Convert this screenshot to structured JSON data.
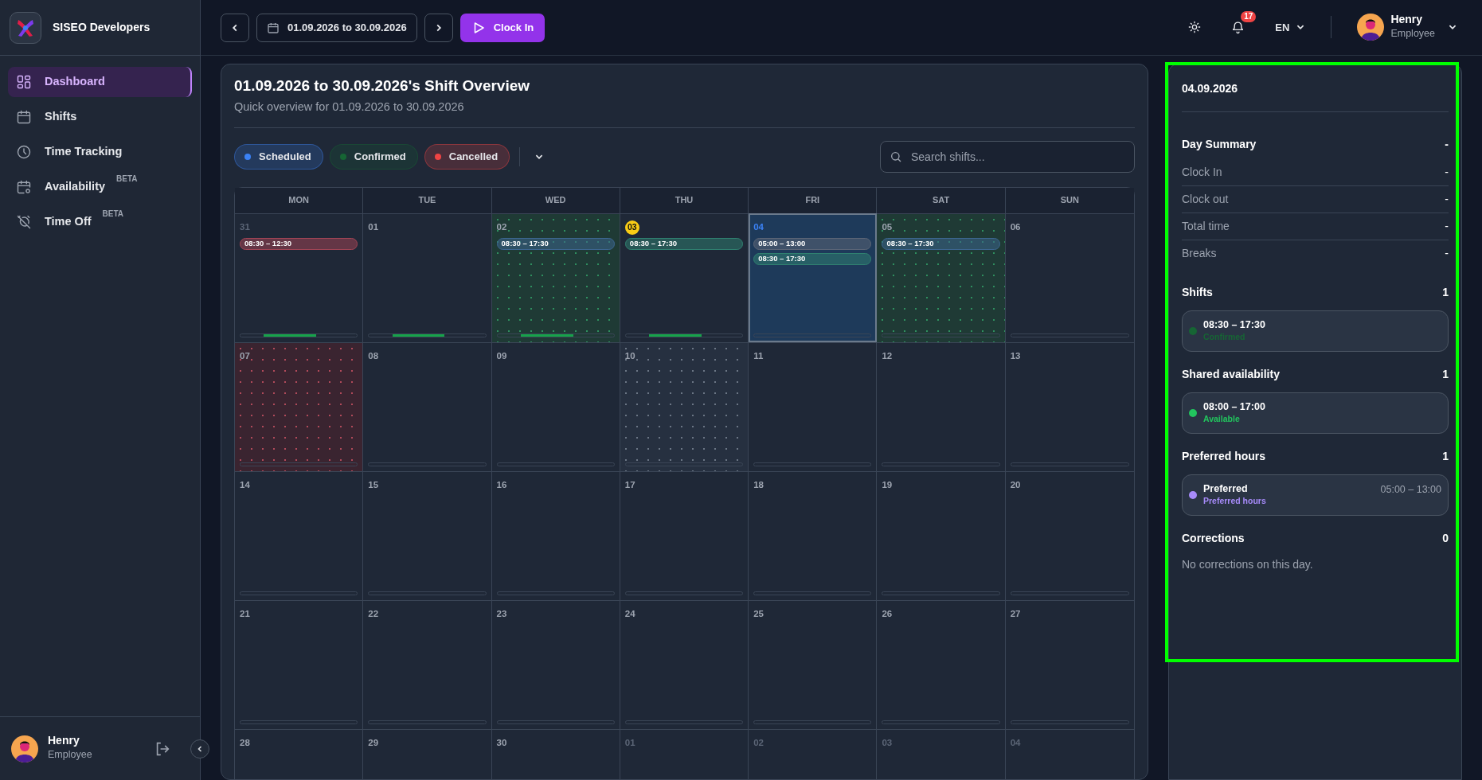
{
  "brand": {
    "name": "SISEO Developers"
  },
  "topbar": {
    "date_range": "01.09.2026 to 30.09.2026",
    "clock_button": "Clock In",
    "notifications": "17",
    "language": "EN",
    "user": {
      "name": "Henry",
      "role": "Employee"
    }
  },
  "sidebar": {
    "items": [
      {
        "label": "Dashboard",
        "selected": true
      },
      {
        "label": "Shifts",
        "selected": false
      },
      {
        "label": "Time Tracking",
        "selected": false
      },
      {
        "label": "Availability",
        "selected": false,
        "tag": "BETA"
      },
      {
        "label": "Time Off",
        "selected": false,
        "tag": "BETA"
      }
    ],
    "user": {
      "name": "Henry",
      "role": "Employee"
    }
  },
  "overview": {
    "title": "01.09.2026 to 30.09.2026's Shift Overview",
    "subtitle": "Quick overview for 01.09.2026 to 30.09.2026",
    "filters": [
      {
        "label": "Scheduled",
        "color": "#3b82f6"
      },
      {
        "label": "Confirmed",
        "color": "#166534"
      },
      {
        "label": "Cancelled",
        "color": "#ef4444"
      }
    ],
    "search": {
      "placeholder": "Search shifts..."
    },
    "weekdays": [
      "MON",
      "TUE",
      "WED",
      "THU",
      "FRI",
      "SAT",
      "SUN"
    ],
    "days": [
      {
        "day": "31",
        "muted": true,
        "today": false,
        "selected": false,
        "kind": "plain",
        "activity": true,
        "shifts": [
          {
            "time": "08:30 – 12:30",
            "color": "#a14455"
          }
        ]
      },
      {
        "day": "01",
        "muted": false,
        "today": false,
        "selected": false,
        "kind": "plain",
        "activity": true
      },
      {
        "day": "02",
        "muted": false,
        "today": false,
        "selected": false,
        "kind": "available",
        "activity": true,
        "shifts": [
          {
            "time": "08:30 – 17:30",
            "color": "#3c6690"
          }
        ]
      },
      {
        "day": "03",
        "muted": false,
        "today": true,
        "selected": false,
        "kind": "plain",
        "activity": true,
        "shifts": [
          {
            "time": "08:30 – 17:30",
            "color": "#2f8070"
          }
        ]
      },
      {
        "day": "04",
        "muted": false,
        "today": false,
        "selected": true,
        "kind": "plain",
        "activity": false,
        "shifts": [
          {
            "time": "05:00 – 13:00",
            "color": "#5b6576"
          },
          {
            "time": "08:30 – 17:30",
            "color": "#2f8070"
          }
        ]
      },
      {
        "day": "05",
        "muted": false,
        "today": false,
        "selected": false,
        "kind": "available",
        "activity": false,
        "shifts": [
          {
            "time": "08:30 – 17:30",
            "color": "#3c6690"
          }
        ]
      },
      {
        "day": "06",
        "muted": false,
        "today": false,
        "selected": false,
        "kind": "plain",
        "activity": false
      },
      {
        "day": "07",
        "muted": false,
        "today": false,
        "selected": false,
        "kind": "unavailable",
        "activity": false
      },
      {
        "day": "08",
        "muted": false,
        "today": false,
        "selected": false,
        "kind": "plain",
        "activity": false
      },
      {
        "day": "09",
        "muted": false,
        "today": false,
        "selected": false,
        "kind": "plain",
        "activity": false
      },
      {
        "day": "10",
        "muted": false,
        "today": false,
        "selected": false,
        "kind": "neutral",
        "activity": false
      },
      {
        "day": "11",
        "muted": false,
        "today": false,
        "selected": false,
        "kind": "plain",
        "activity": false
      },
      {
        "day": "12",
        "muted": false,
        "today": false,
        "selected": false,
        "kind": "plain",
        "activity": false
      },
      {
        "day": "13",
        "muted": false,
        "today": false,
        "selected": false,
        "kind": "plain",
        "activity": false
      },
      {
        "day": "14",
        "muted": false,
        "today": false,
        "selected": false,
        "kind": "plain",
        "activity": false
      },
      {
        "day": "15",
        "muted": false,
        "today": false,
        "selected": false,
        "kind": "plain",
        "activity": false
      },
      {
        "day": "16",
        "muted": false,
        "today": false,
        "selected": false,
        "kind": "plain",
        "activity": false
      },
      {
        "day": "17",
        "muted": false,
        "today": false,
        "selected": false,
        "kind": "plain",
        "activity": false
      },
      {
        "day": "18",
        "muted": false,
        "today": false,
        "selected": false,
        "kind": "plain",
        "activity": false
      },
      {
        "day": "19",
        "muted": false,
        "today": false,
        "selected": false,
        "kind": "plain",
        "activity": false
      },
      {
        "day": "20",
        "muted": false,
        "today": false,
        "selected": false,
        "kind": "plain",
        "activity": false
      },
      {
        "day": "21",
        "muted": false,
        "today": false,
        "selected": false,
        "kind": "plain",
        "activity": false
      },
      {
        "day": "22",
        "muted": false,
        "today": false,
        "selected": false,
        "kind": "plain",
        "activity": false
      },
      {
        "day": "23",
        "muted": false,
        "today": false,
        "selected": false,
        "kind": "plain",
        "activity": false
      },
      {
        "day": "24",
        "muted": false,
        "today": false,
        "selected": false,
        "kind": "plain",
        "activity": false
      },
      {
        "day": "25",
        "muted": false,
        "today": false,
        "selected": false,
        "kind": "plain",
        "activity": false
      },
      {
        "day": "26",
        "muted": false,
        "today": false,
        "selected": false,
        "kind": "plain",
        "activity": false
      },
      {
        "day": "27",
        "muted": false,
        "today": false,
        "selected": false,
        "kind": "plain",
        "activity": false
      },
      {
        "day": "28",
        "muted": false,
        "today": false,
        "selected": false,
        "kind": "plain"
      },
      {
        "day": "29",
        "muted": false,
        "today": false,
        "selected": false,
        "kind": "plain"
      },
      {
        "day": "30",
        "muted": false,
        "today": false,
        "selected": false,
        "kind": "plain"
      },
      {
        "day": "01",
        "muted": true,
        "today": false,
        "selected": false,
        "kind": "plain"
      },
      {
        "day": "02",
        "muted": true,
        "today": false,
        "selected": false,
        "kind": "plain"
      },
      {
        "day": "03",
        "muted": true,
        "today": false,
        "selected": false,
        "kind": "plain"
      },
      {
        "day": "04",
        "muted": true,
        "today": false,
        "selected": false,
        "kind": "plain"
      }
    ]
  },
  "day_panel": {
    "date": "04.09.2026",
    "summary": {
      "title": "Day Summary",
      "value": "-",
      "rows": [
        {
          "label": "Clock In",
          "value": "-"
        },
        {
          "label": "Clock out",
          "value": "-"
        },
        {
          "label": "Total time",
          "value": "-"
        },
        {
          "label": "Breaks",
          "value": "-"
        }
      ]
    },
    "sections": [
      {
        "title": "Shifts",
        "count": "1",
        "entries": [
          {
            "title": "08:30 – 17:30",
            "subtitle": "Confirmed",
            "color": "#166534"
          }
        ]
      },
      {
        "title": "Shared availability",
        "count": "1",
        "entries": [
          {
            "title": "08:00 – 17:00",
            "subtitle": "Available",
            "color": "#22c55e"
          }
        ]
      },
      {
        "title": "Preferred hours",
        "count": "1",
        "entries": [
          {
            "title": "Preferred",
            "subtitle": "Preferred hours",
            "time": "05:00 – 13:00",
            "color": "#a78bfa"
          }
        ]
      },
      {
        "title": "Corrections",
        "count": "0",
        "empty_text": "No corrections on this day."
      }
    ]
  }
}
